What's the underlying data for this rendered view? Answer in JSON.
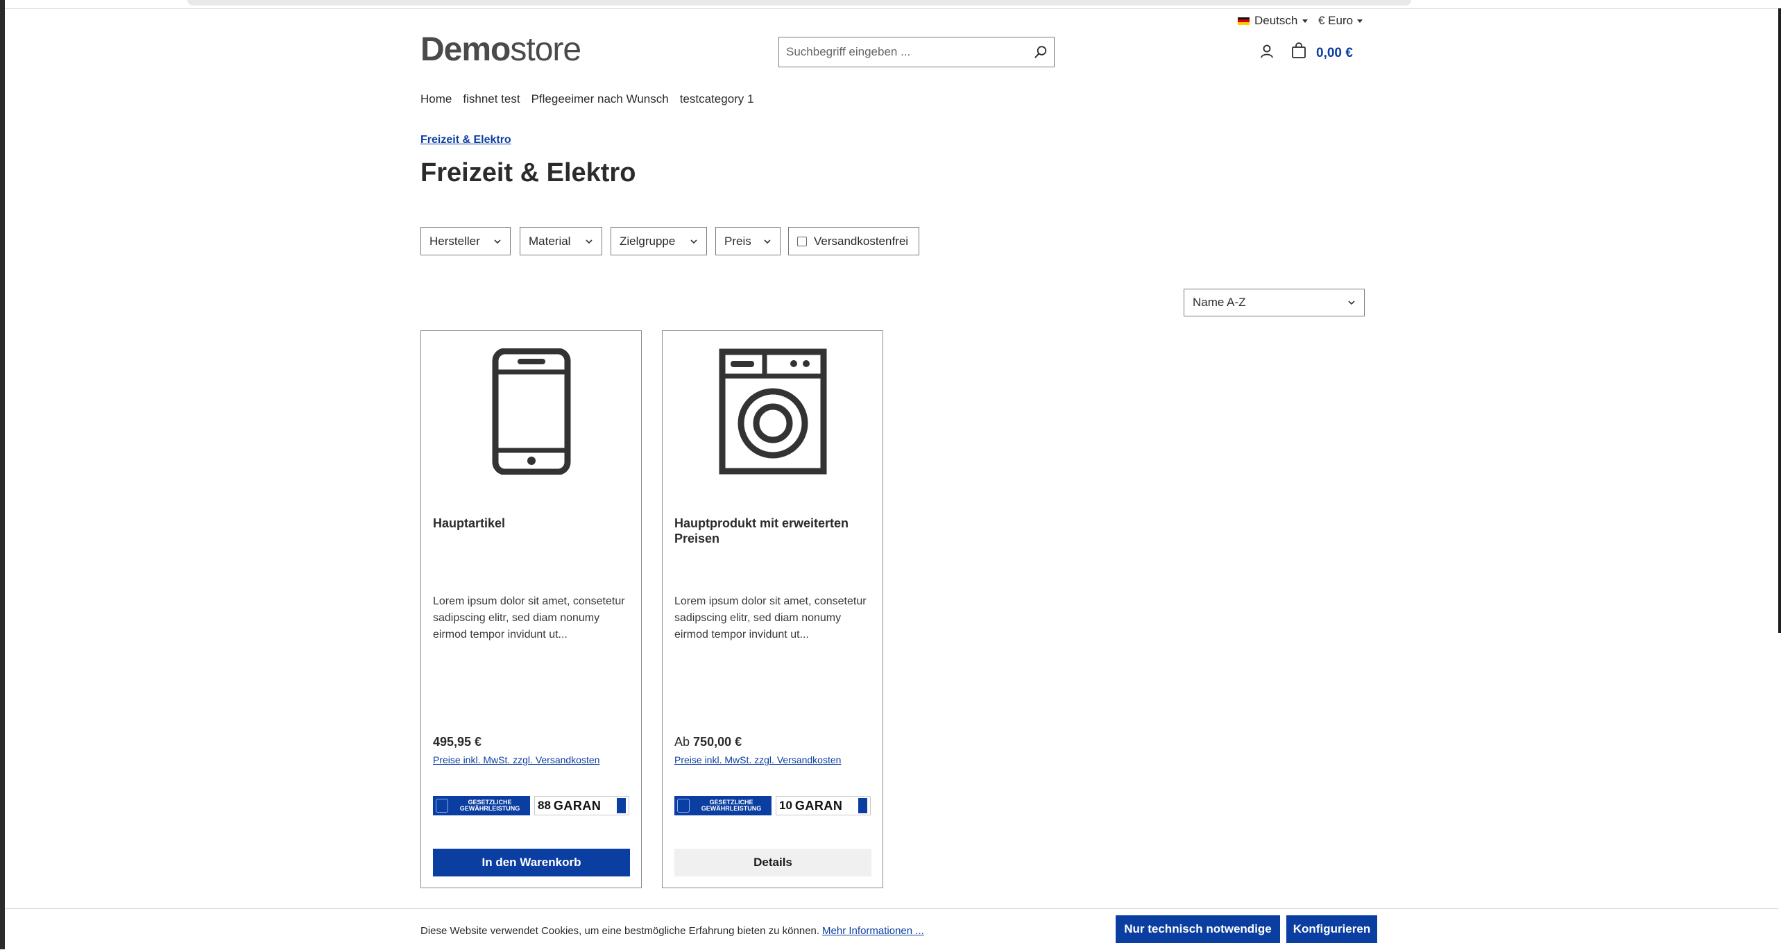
{
  "topbar": {
    "language": "Deutsch",
    "currency": "€ Euro"
  },
  "header": {
    "logo_bold": "Demo",
    "logo_light": "store",
    "search_placeholder": "Suchbegriff eingeben ...",
    "cart_total": "0,00 €"
  },
  "nav": {
    "items": [
      {
        "label": "Home"
      },
      {
        "label": "fishnet test"
      },
      {
        "label": "Pflegeeimer nach Wunsch"
      },
      {
        "label": "testcategory 1"
      }
    ]
  },
  "breadcrumb": "Freizeit & Elektro",
  "page_title": "Freizeit & Elektro",
  "filters": {
    "manufacturer": "Hersteller",
    "material": "Material",
    "target_group": "Zielgruppe",
    "price": "Preis",
    "free_shipping": "Versandkostenfrei"
  },
  "sort": {
    "selected": "Name A-Z"
  },
  "products": [
    {
      "name": "Hauptartikel",
      "image_icon": "smartphone-icon",
      "description": "Lorem ipsum dolor sit amet, consetetur sadipscing elitr, sed diam nonumy eirmod tempor invidunt ut...",
      "price_prefix": "",
      "price": "495,95 €",
      "vat_note": "Preise inkl. MwSt. zzgl. Versandkosten",
      "warranty_badge": "GESETZLICHE GEWÄHRLEISTUNG",
      "guarantee_num": "88",
      "guarantee_word": "GARAN",
      "button": "In den Warenkorb"
    },
    {
      "name": "Hauptprodukt mit erweiterten Preisen",
      "image_icon": "washing-machine-icon",
      "description": "Lorem ipsum dolor sit amet, consetetur sadipscing elitr, sed diam nonumy eirmod tempor invidunt ut...",
      "price_prefix": "Ab",
      "price": "750,00 €",
      "vat_note": "Preise inkl. MwSt. zzgl. Versandkosten",
      "warranty_badge": "GESETZLICHE GEWÄHRLEISTUNG",
      "guarantee_num": "10",
      "guarantee_word": "GARAN",
      "button": "Details"
    }
  ],
  "cookie": {
    "text": "Diese Website verwendet Cookies, um eine bestmögliche Erfahrung bieten zu können.",
    "link": "Mehr Informationen ...",
    "btn_technical": "Nur technisch notwendige",
    "btn_configure": "Konfigurieren"
  },
  "colors": {
    "brand": "#0b3ea1"
  }
}
